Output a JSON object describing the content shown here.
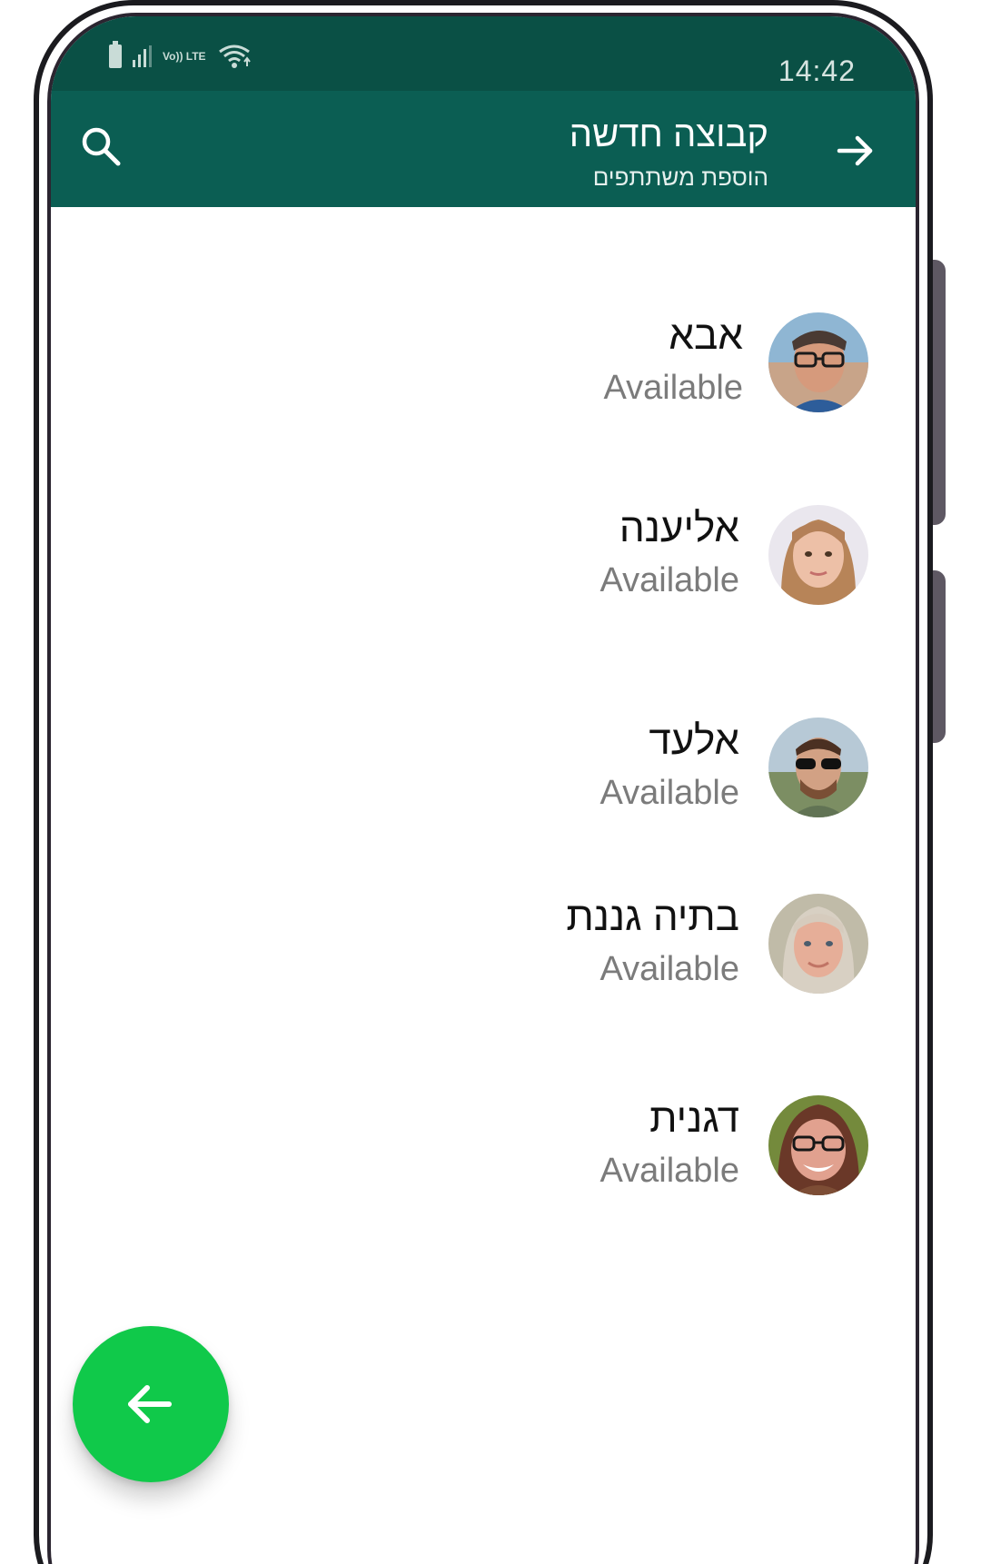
{
  "status_bar": {
    "time": "14:42",
    "network_label": "Vo)) LTE"
  },
  "app_bar": {
    "title": "קבוצה חדשה",
    "subtitle": "הוספת משתתפים",
    "search_icon": "search-icon",
    "back_icon": "arrow-right-icon"
  },
  "contacts": [
    {
      "name": "אבא",
      "status": "Available"
    },
    {
      "name": "אליענה",
      "status": "Available"
    },
    {
      "name": "אלעד",
      "status": "Available"
    },
    {
      "name": "בתיה גננת",
      "status": "Available"
    },
    {
      "name": "דגנית",
      "status": "Available"
    }
  ],
  "fab": {
    "icon": "arrow-left-icon"
  },
  "colors": {
    "status_bar": "#0a5045",
    "app_bar": "#0b5e53",
    "fab": "#10c94a",
    "secondary_text": "#7b7b7b"
  }
}
